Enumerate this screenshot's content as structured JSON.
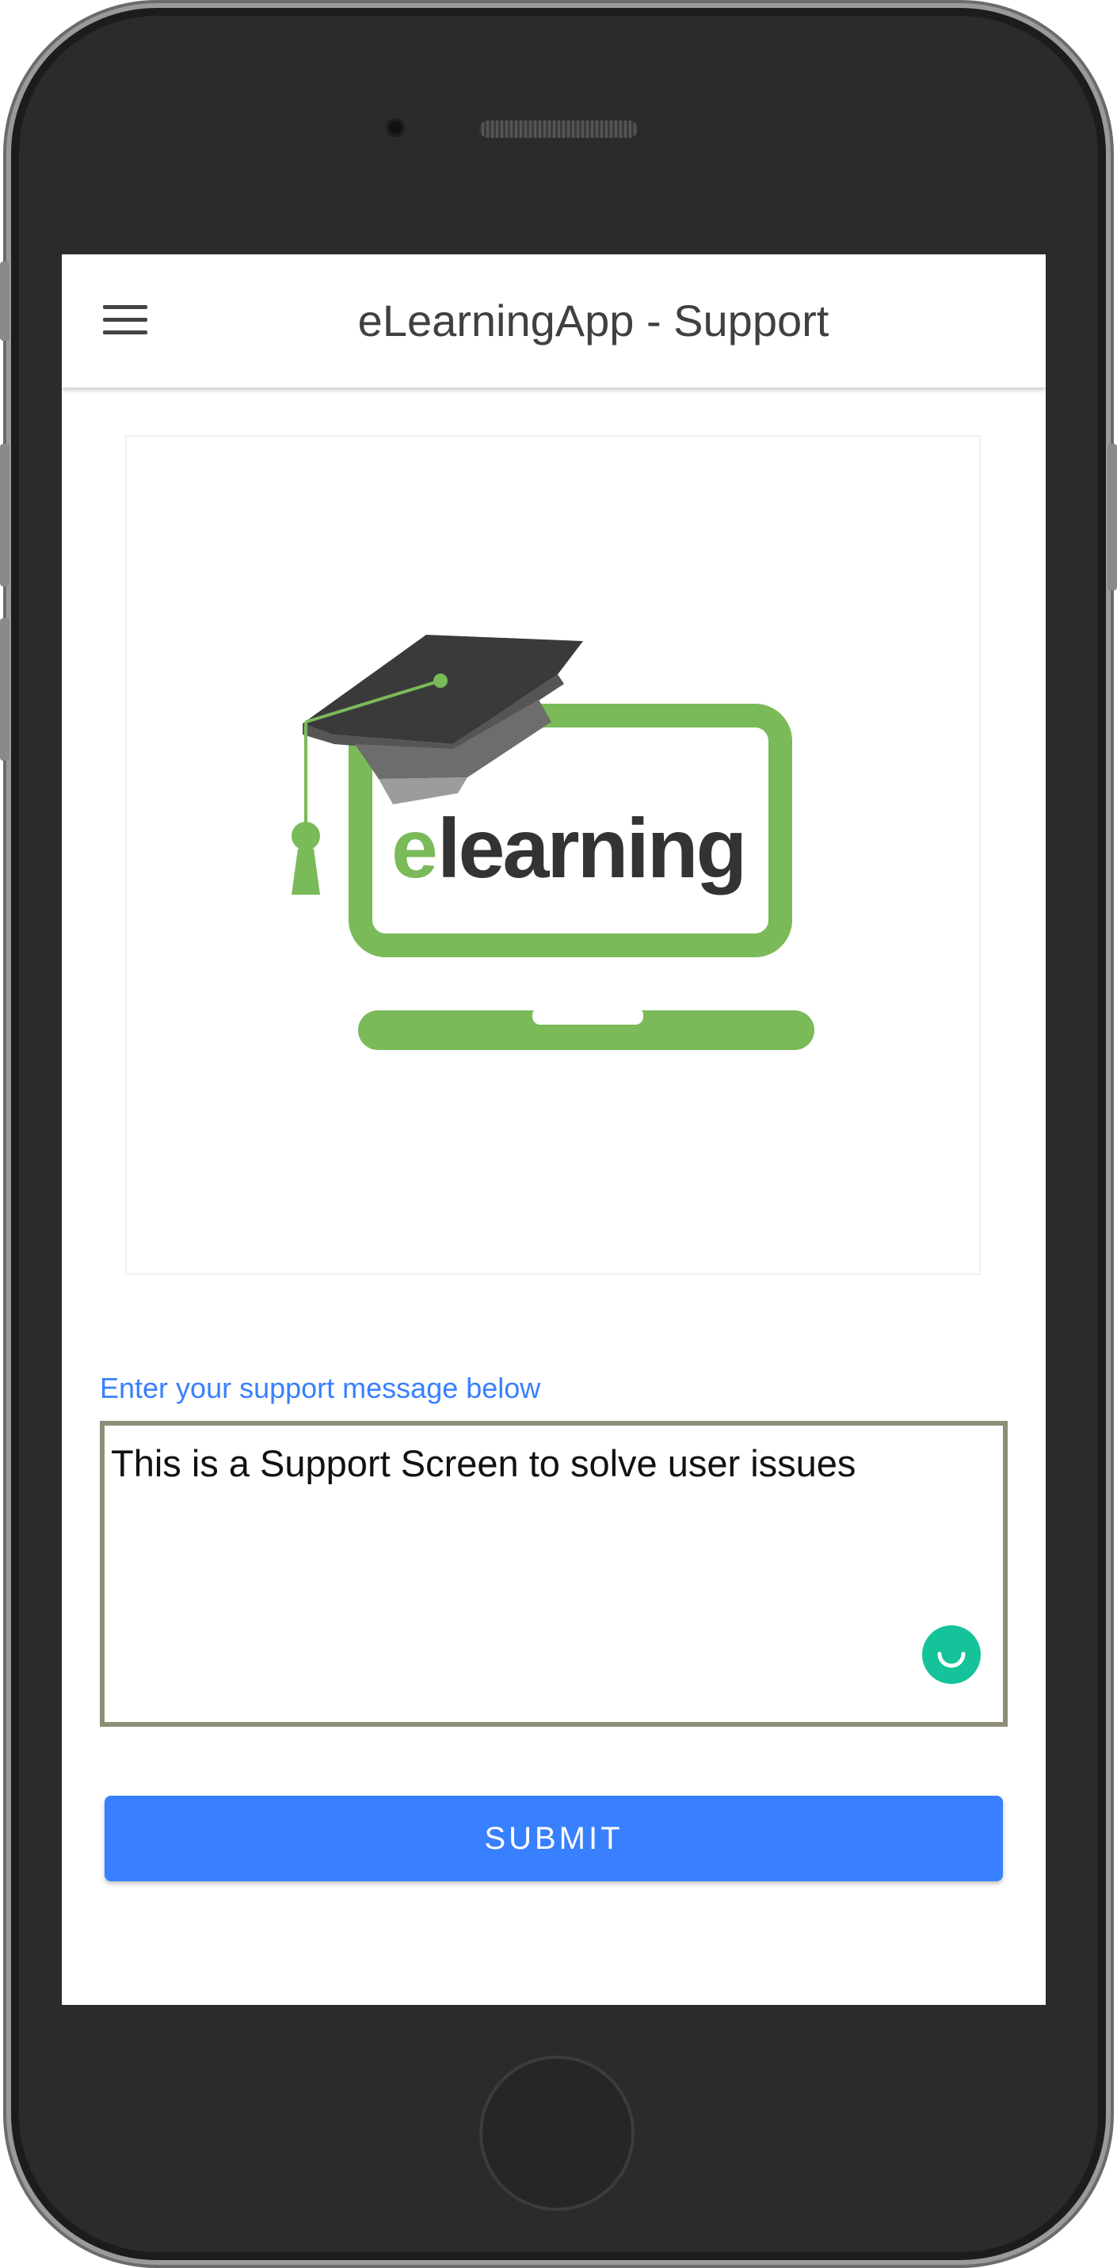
{
  "header": {
    "title": "eLearningApp - Support",
    "menu_icon": "menu-icon"
  },
  "logo": {
    "text_accent": "e",
    "text_main": "learning",
    "colors": {
      "green": "#7aba59",
      "dark": "#333333",
      "cap": "#3a3a3a"
    }
  },
  "form": {
    "label": "Enter your support message below",
    "message_value": "This is a Support Screen to solve user issues",
    "assist_icon": "grammarly-icon"
  },
  "actions": {
    "submit_label": "SUBMIT"
  },
  "colors": {
    "primary": "#3880ff",
    "textarea_border": "#8e8e78",
    "assist": "#15c39a"
  }
}
